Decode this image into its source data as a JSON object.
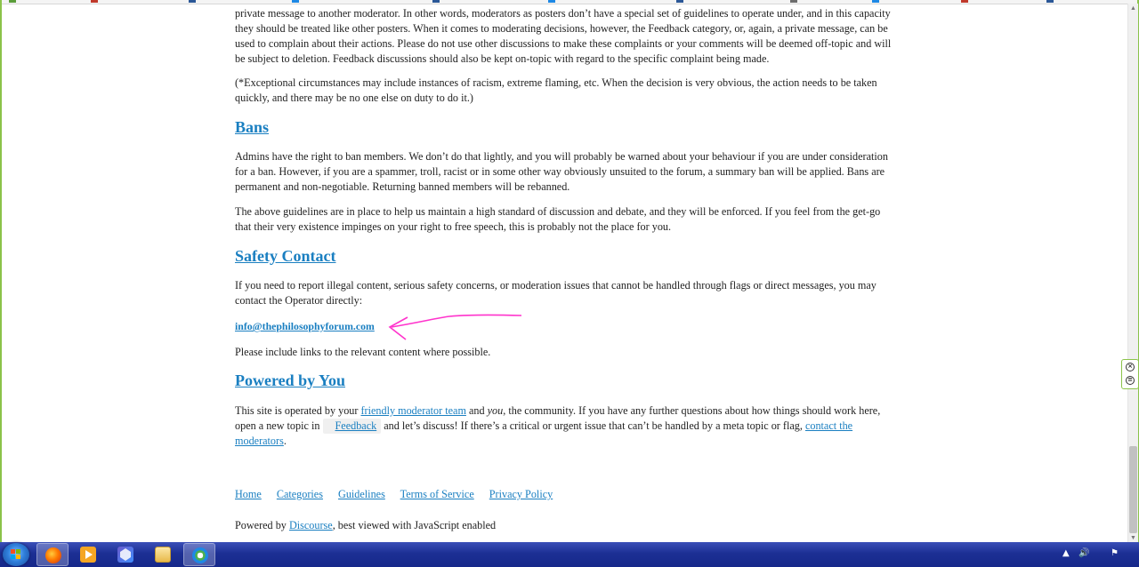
{
  "article": {
    "p_moderators_end": "private message to another moderator. In other words, moderators as posters don’t have a special set of guidelines to operate under, and in this capacity they should be treated like other posters. When it comes to moderating decisions, however, the Feedback category, or, again, a private message, can be used to complain about their actions. Please do not use other discussions to make these complaints or your comments will be deemed off-topic and will be subject to deletion. Feedback discussions should also be kept on-topic with regard to the specific complaint being made.",
    "p_exceptional": "(*Exceptional circumstances may include instances of racism, extreme flaming, etc. When the decision is very obvious, the action needs to be taken quickly, and there may be no one else on duty to do it.)",
    "bans": {
      "heading": "Bans",
      "p1": "Admins have the right to ban members. We don’t do that lightly, and you will probably be warned about your behaviour if you are under consideration for a ban. However, if you are a spammer, troll, racist or in some other way obviously unsuited to the forum, a summary ban will be applied. Bans are permanent and non-negotiable. Returning banned members will be rebanned.",
      "p2": "The above guidelines are in place to help us maintain a high standard of discussion and debate, and they will be enforced. If you feel from the get-go that their very existence impinges on your right to free speech, this is probably not the place for you."
    },
    "safety": {
      "heading": "Safety Contact",
      "p1": "If you need to report illegal content, serious safety concerns, or moderation issues that cannot be handled through flags or direct messages, you may contact the Operator directly:",
      "email": "info@thephilosophyforum.com",
      "p2": "Please include links to the relevant content where possible."
    },
    "powered": {
      "heading": "Powered by You",
      "t1": "This site is operated by your ",
      "link_team": "friendly moderator team",
      "t2": " and ",
      "you": "you",
      "t3": ", the community. If you have any further questions about how things should work here, open a new topic in ",
      "feedback_badge": "Feedback",
      "t4": " and let’s discuss! If there’s a critical or urgent issue that can’t be handled by a meta topic or flag, ",
      "link_contact": "contact the moderators",
      "t5": "."
    }
  },
  "footer": {
    "links": [
      "Home",
      "Categories",
      "Guidelines",
      "Terms of Service",
      "Privacy Policy"
    ],
    "powered_prefix": "Powered by ",
    "powered_link": "Discourse",
    "powered_suffix": ", best viewed with JavaScript enabled"
  },
  "annotation": {
    "color": "#ff33cc",
    "meaning": "arrow pointing at email"
  },
  "colors": {
    "link": "#1a7fc1",
    "text": "#222222",
    "frame": "#8bc34a",
    "taskbar": "#1c2f94"
  },
  "taskbar": {
    "apps": [
      {
        "name": "firefox-icon",
        "active": true
      },
      {
        "name": "media-player-icon",
        "active": false
      },
      {
        "name": "shield-app-icon",
        "active": false
      },
      {
        "name": "file-manager-icon",
        "active": false
      },
      {
        "name": "chrome-like-icon",
        "active": false
      }
    ],
    "tray": {
      "arrow": "▲",
      "volume": "🔊",
      "flag": "⚑"
    }
  }
}
